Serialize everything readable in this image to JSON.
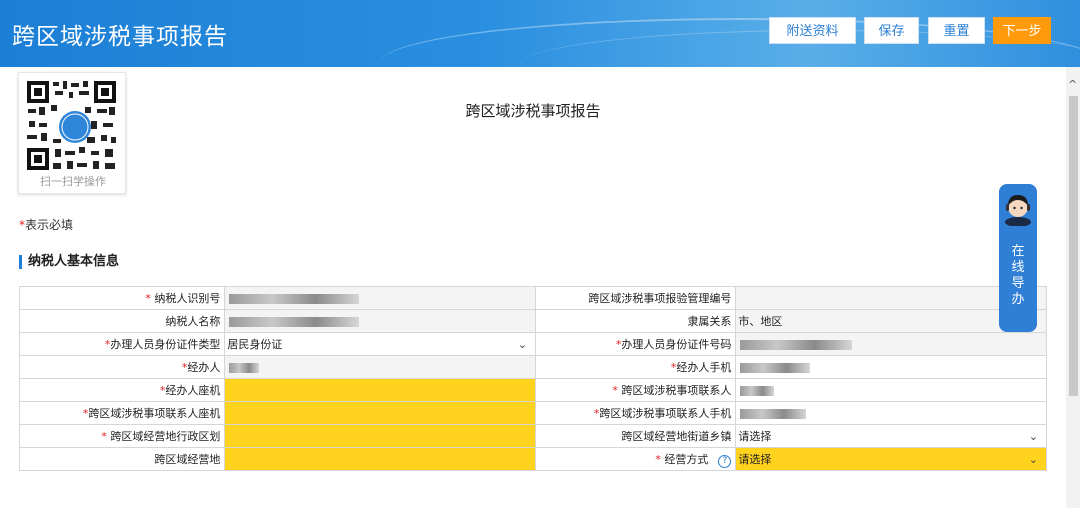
{
  "header": {
    "title": "跨区域涉税事项报告",
    "buttons": {
      "attach": "附送资料",
      "save": "保存",
      "reset": "重置",
      "next": "下一步"
    }
  },
  "qr": {
    "caption": "扫一扫学操作"
  },
  "document": {
    "title": "跨区域涉税事项报告",
    "required_prefix": "*",
    "required_note": "表示必填"
  },
  "section": {
    "title": "纳税人基本信息"
  },
  "form": {
    "row1": {
      "label_left": "纳税人识别号",
      "label_right": "跨区域涉税事项报验管理编号"
    },
    "row2": {
      "label_left": "纳税人名称",
      "label_right": "隶属关系",
      "value_right": "市、地区"
    },
    "row3": {
      "label_left": "办理人员身份证件类型",
      "value_left": "居民身份证",
      "label_right": "办理人员身份证件号码"
    },
    "row4": {
      "label_left": "经办人",
      "label_right": "经办人手机"
    },
    "row5": {
      "label_left": "经办人座机",
      "label_right": "跨区域涉税事项联系人"
    },
    "row6": {
      "label_left": "跨区域涉税事项联系人座机",
      "label_right": "跨区域涉税事项联系人手机"
    },
    "row7": {
      "label_left": "跨区域经营地行政区划",
      "label_right": "跨区域经营地街道乡镇",
      "value_right": "请选择"
    },
    "row8": {
      "label_left": "跨区域经营地",
      "label_right": "经营方式",
      "value_right": "请选择",
      "help": "?"
    }
  },
  "guide": {
    "label": "在线导办"
  },
  "icons": {
    "caret": "⌄",
    "scroll_up": "^"
  },
  "colors": {
    "header": "#1c7fd6",
    "next_button": "#ff9a0a",
    "required_field": "#ffd21e",
    "required_star": "#e02020"
  }
}
